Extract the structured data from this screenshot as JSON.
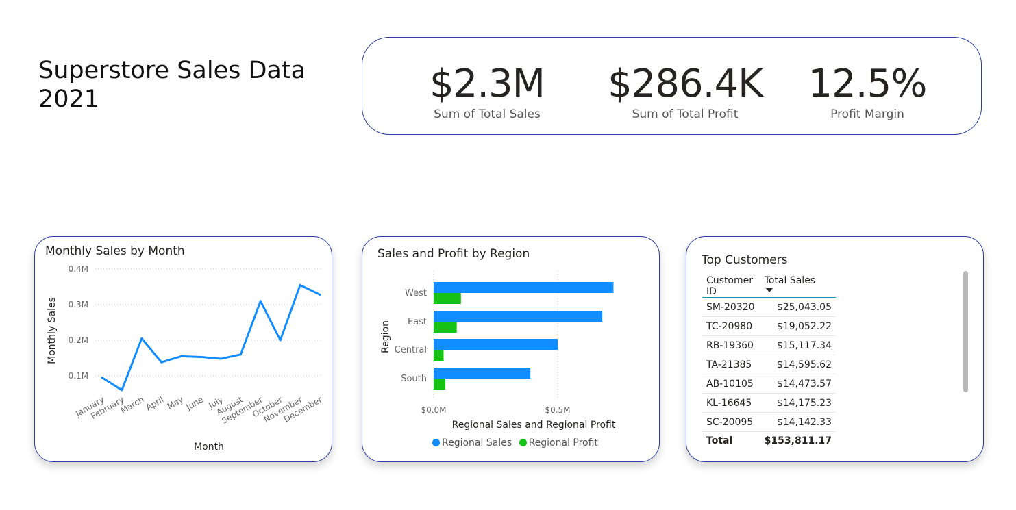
{
  "title": {
    "line1": "Superstore Sales Data",
    "line2": "2021"
  },
  "kpis": [
    {
      "value": "$2.3M",
      "label": "Sum of Total Sales"
    },
    {
      "value": "$286.4K",
      "label": "Sum of Total Profit"
    },
    {
      "value": "12.5%",
      "label": "Profit Margin"
    }
  ],
  "colors": {
    "sales": "#118DFF",
    "profit": "#15C215",
    "border": "#2a3d9e",
    "table_accent": "#1b8bb8"
  },
  "chart_data": [
    {
      "type": "line",
      "title": "Monthly Sales by Month",
      "xlabel": "Month",
      "ylabel": "Monthly Sales",
      "categories": [
        "January",
        "February",
        "March",
        "April",
        "May",
        "June",
        "July",
        "August",
        "September",
        "October",
        "November",
        "December"
      ],
      "series": [
        {
          "values": [
            0.095,
            0.06,
            0.205,
            0.138,
            0.155,
            0.153,
            0.148,
            0.16,
            0.31,
            0.2,
            0.355,
            0.328
          ]
        }
      ],
      "ylim": [
        0,
        0.4
      ],
      "yticks": [
        0.1,
        0.2,
        0.3,
        0.4
      ],
      "yticklabels": [
        "0.1M",
        "0.2M",
        "0.3M",
        "0.4M"
      ],
      "grid": true
    },
    {
      "type": "bar",
      "orientation": "horizontal",
      "title": "Sales and Profit by Region",
      "xlabel": "Regional Sales and Regional Profit",
      "ylabel": "Region",
      "categories": [
        "West",
        "East",
        "Central",
        "South"
      ],
      "series": [
        {
          "name": "Regional Sales",
          "values": [
            0.725,
            0.68,
            0.5,
            0.39
          ]
        },
        {
          "name": "Regional Profit",
          "values": [
            0.11,
            0.093,
            0.04,
            0.047
          ]
        }
      ],
      "xlim": [
        0,
        0.9
      ],
      "xticks": [
        0,
        0.5
      ],
      "xticklabels": [
        "$0.0M",
        "$0.5M"
      ],
      "legend": "bottom-center",
      "grid": true
    }
  ],
  "table": {
    "title": "Top Customers",
    "headers": [
      "Customer ID",
      "Total Sales"
    ],
    "rows": [
      [
        "SM-20320",
        "$25,043.05"
      ],
      [
        "TC-20980",
        "$19,052.22"
      ],
      [
        "RB-19360",
        "$15,117.34"
      ],
      [
        "TA-21385",
        "$14,595.62"
      ],
      [
        "AB-10105",
        "$14,473.57"
      ],
      [
        "KL-16645",
        "$14,175.23"
      ],
      [
        "SC-20095",
        "$14,142.33"
      ]
    ],
    "total_label": "Total",
    "total_value": "$153,811.17"
  }
}
